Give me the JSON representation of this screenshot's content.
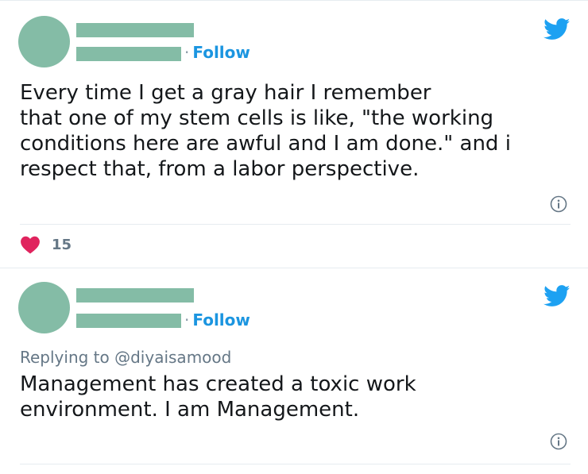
{
  "colors": {
    "placeholder": "#84bca6",
    "twitter_blue": "#1da1f2",
    "follow_blue": "#1b95e0",
    "heart_pink": "#e0245e",
    "muted_gray": "#657786"
  },
  "tweets": [
    {
      "follow_label": "Follow",
      "follow_separator": "·",
      "text": "Every time I get a gray hair I remember\nthat one of my stem cells is like, \"the working\nconditions here are awful and I am done.\" and i\nrespect that, from a labor perspective.",
      "like_count": "15",
      "icons": [
        "twitter-bird-icon",
        "info-icon",
        "heart-icon"
      ]
    },
    {
      "follow_label": "Follow",
      "follow_separator": "·",
      "reply_context": "Replying to @diyaisamood",
      "text": "Management has created a toxic work\nenvironment. I am Management.",
      "icons": [
        "twitter-bird-icon",
        "info-icon"
      ]
    }
  ]
}
